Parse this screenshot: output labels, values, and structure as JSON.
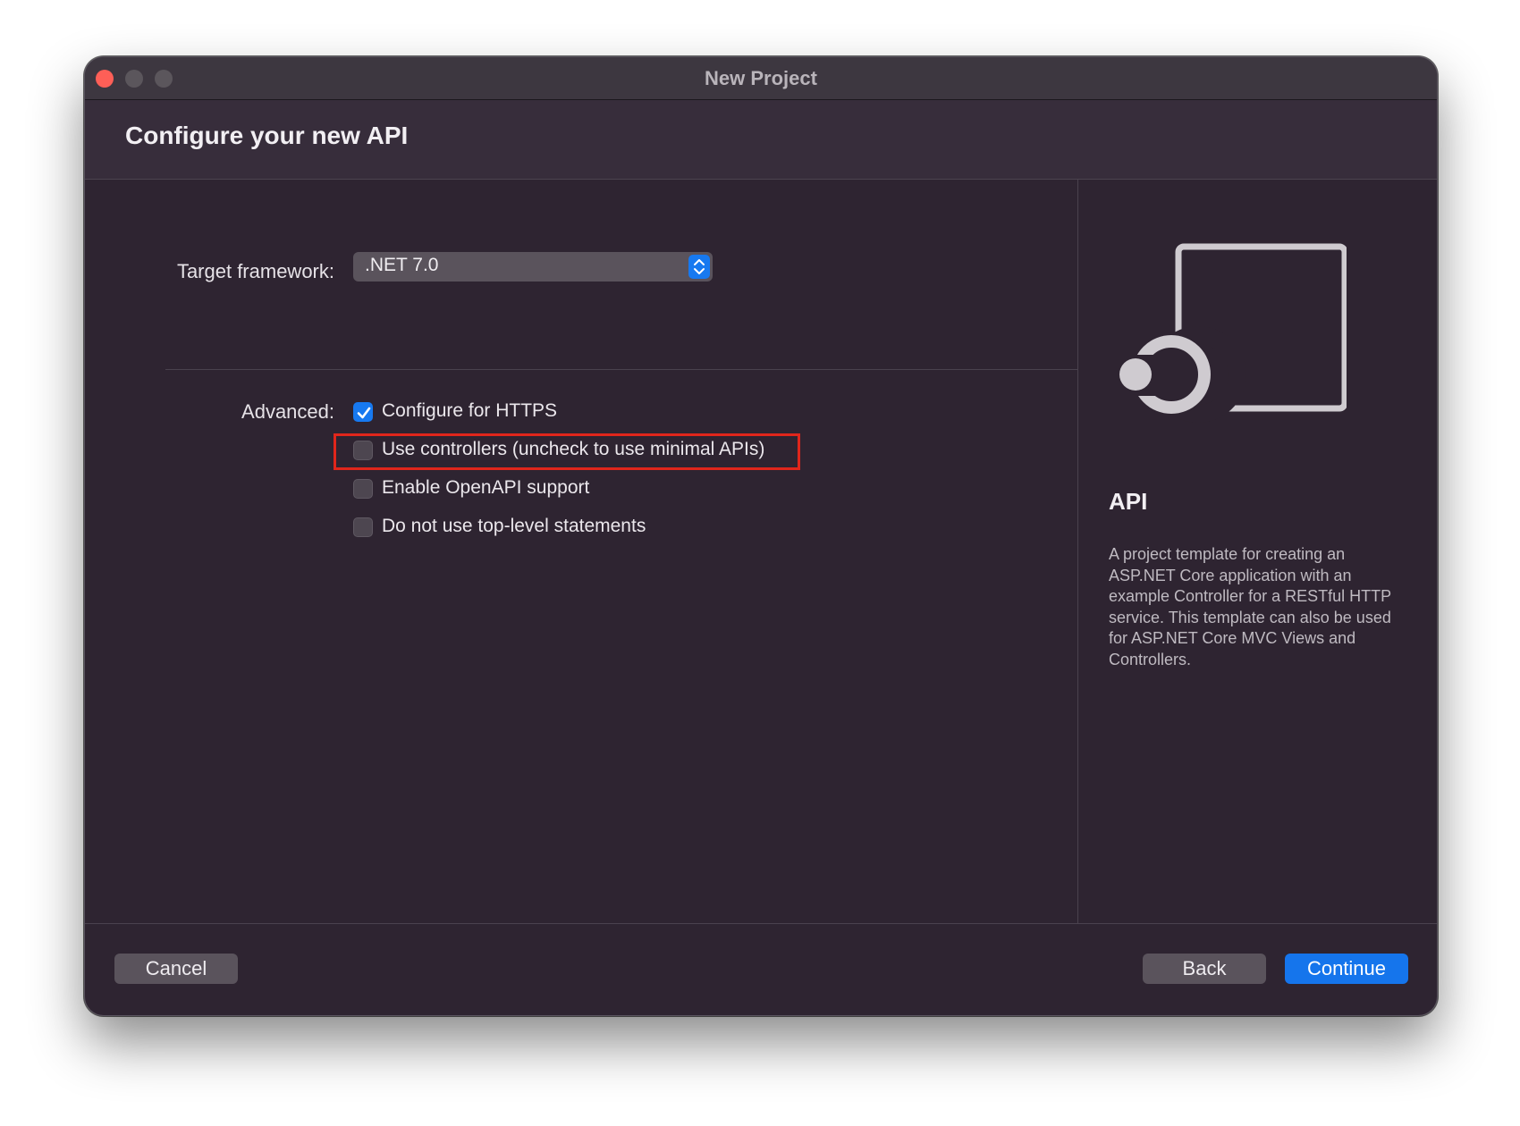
{
  "window": {
    "title": "New Project"
  },
  "header": {
    "title": "Configure your new API"
  },
  "form": {
    "framework_label": "Target framework:",
    "framework_value": ".NET 7.0",
    "advanced_label": "Advanced:",
    "options": [
      {
        "label": "Configure for HTTPS",
        "checked": true
      },
      {
        "label": "Use controllers (uncheck to use minimal APIs)",
        "checked": false,
        "highlighted": true
      },
      {
        "label": "Enable OpenAPI support",
        "checked": false
      },
      {
        "label": "Do not use top-level statements",
        "checked": false
      }
    ]
  },
  "side": {
    "icon": "api-template-icon",
    "title": "API",
    "description": "A project template for creating an ASP.NET Core application with an example Controller for a RESTful HTTP service. This template can also be used for ASP.NET Core MVC Views and Controllers."
  },
  "footer": {
    "cancel_label": "Cancel",
    "back_label": "Back",
    "continue_label": "Continue"
  },
  "colors": {
    "accent": "#1779f0",
    "highlight_border": "#e0261b",
    "window_bg": "#2e2431"
  }
}
